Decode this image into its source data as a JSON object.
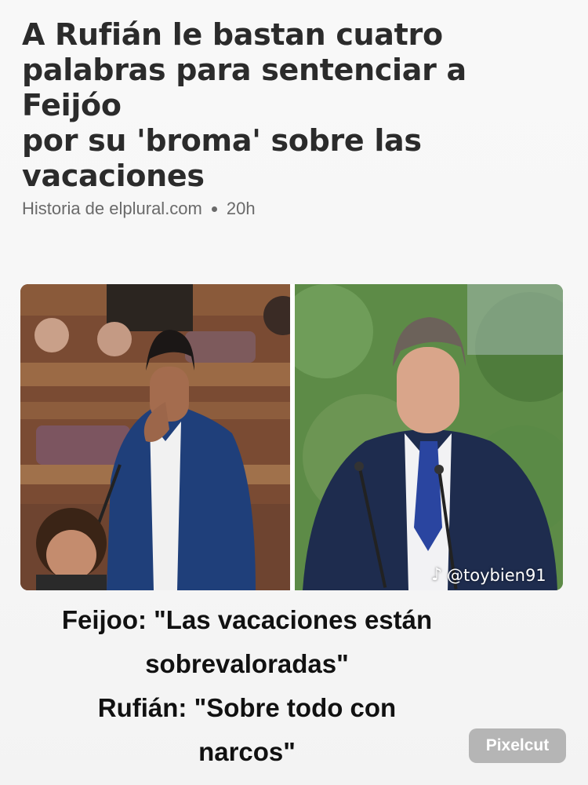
{
  "article": {
    "headline_lines": [
      "A Rufián le bastan cuatro",
      "palabras para sentenciar a Feijóo",
      "por su 'broma' sobre las",
      "vacaciones"
    ],
    "source": "Historia de elplural.com",
    "time": "20h"
  },
  "images": {
    "left": "photo of Rufián pointing in Congress",
    "right": "photo of Feijóo speaking at podium"
  },
  "watermark": {
    "icon": "tiktok-icon",
    "handle": "@toybien91"
  },
  "caption": {
    "line1": "Feijoo: \"Las vacaciones están",
    "line2": "sobrevaloradas\"",
    "line3": "Rufián: \"Sobre todo con",
    "line4": "narcos\""
  },
  "app_badge": {
    "label": "Pixelcut"
  }
}
